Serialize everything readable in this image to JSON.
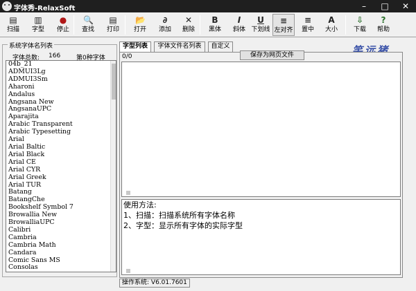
{
  "window": {
    "title": "字体秀-RelaxSoft"
  },
  "toolbar": [
    {
      "id": "scan",
      "label": "扫描",
      "icon": "printer-icon",
      "glyph": "▤"
    },
    {
      "id": "glyphs",
      "label": "字型",
      "icon": "font-print-icon",
      "glyph": "▥"
    },
    {
      "id": "stop",
      "label": "停止",
      "icon": "stop-icon",
      "glyph": "●"
    },
    {
      "id": "find",
      "label": "查找",
      "icon": "find-document-icon",
      "glyph": "🔍"
    },
    {
      "id": "print",
      "label": "打印",
      "icon": "print-icon",
      "glyph": "▤"
    },
    {
      "id": "open",
      "label": "打开",
      "icon": "open-folder-icon",
      "glyph": "📂"
    },
    {
      "id": "add",
      "label": "添加",
      "icon": "paperclip-icon",
      "glyph": "∂"
    },
    {
      "id": "delete",
      "label": "删除",
      "icon": "delete-x-icon",
      "glyph": "✕"
    },
    {
      "id": "bold",
      "label": "黑体",
      "icon": "bold-icon",
      "glyph": "B"
    },
    {
      "id": "italic",
      "label": "斜体",
      "icon": "italic-icon",
      "glyph": "I"
    },
    {
      "id": "underline",
      "label": "下划线",
      "icon": "underline-icon",
      "glyph": "U"
    },
    {
      "id": "align-left",
      "label": "左对齐",
      "icon": "align-left-icon",
      "glyph": "≡"
    },
    {
      "id": "center",
      "label": "置中",
      "icon": "align-center-icon",
      "glyph": "≡"
    },
    {
      "id": "size",
      "label": "大小",
      "icon": "font-size-icon",
      "glyph": "A"
    },
    {
      "id": "download",
      "label": "下载",
      "icon": "download-icon",
      "glyph": "⇩"
    },
    {
      "id": "help",
      "label": "帮助",
      "icon": "help-icon",
      "glyph": "?"
    }
  ],
  "sidebar": {
    "legend": "系统字体名列表",
    "count_label": "字体总数:",
    "count_value": "166",
    "shown_label": "第0种字体",
    "fonts": [
      "04b_21",
      "ADMUI3Lg",
      "ADMUI3Sm",
      "Aharoni",
      "Andalus",
      "Angsana New",
      "AngsanaUPC",
      "Aparajita",
      "Arabic Transparent",
      "Arabic Typesetting",
      "Arial",
      "Arial Baltic",
      "Arial Black",
      "Arial CE",
      "Arial CYR",
      "Arial Greek",
      "Arial TUR",
      "Batang",
      "BatangChe",
      "Bookshelf Symbol 7",
      "Browallia New",
      "BrowalliaUPC",
      "Calibri",
      "Cambria",
      "Cambria Math",
      "Candara",
      "Comic Sans MS",
      "Consolas"
    ]
  },
  "tabs": [
    "字型列表",
    "字体文件名列表",
    "自定义"
  ],
  "brand": "笑远猪",
  "main": {
    "counter": "0/0",
    "save_button": "保存为网页文件",
    "instructions": [
      "使用方法:",
      "1、扫描：扫描系统所有字体名称",
      "2、字型：显示所有字体的实际字型"
    ]
  },
  "status": {
    "os_label": "操作系统:",
    "os_version": "V6.01.7601"
  }
}
